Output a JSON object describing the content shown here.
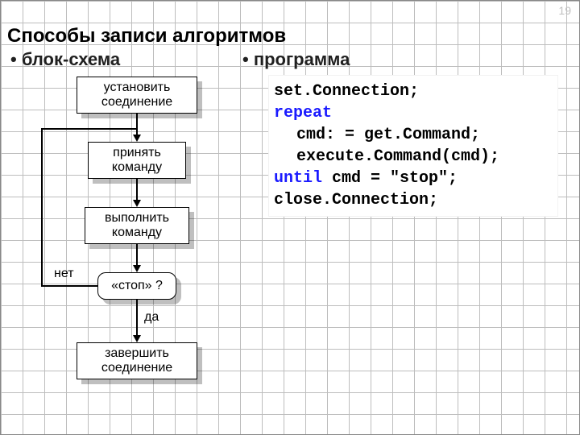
{
  "page_number": "19",
  "title": "Способы записи алгоритмов",
  "columns": {
    "left_heading": "• блок-схема",
    "right_heading": "• программа"
  },
  "flowchart": {
    "step1": "установить\nсоединение",
    "step2": "принять\nкоманду",
    "step3": "выполнить\nкоманду",
    "decision": "«стоп» ?",
    "no_label": "нет",
    "yes_label": "да",
    "step5": "завершить\nсоединение"
  },
  "code": {
    "l1a": "set.Connection;",
    "l2a": "repeat",
    "l3a": "cmd: = get.Command;",
    "l4a": "execute.Command(cmd);",
    "l5a": "until",
    "l5b": " cmd = \"stop\";",
    "l6a": "close.Connection;"
  }
}
